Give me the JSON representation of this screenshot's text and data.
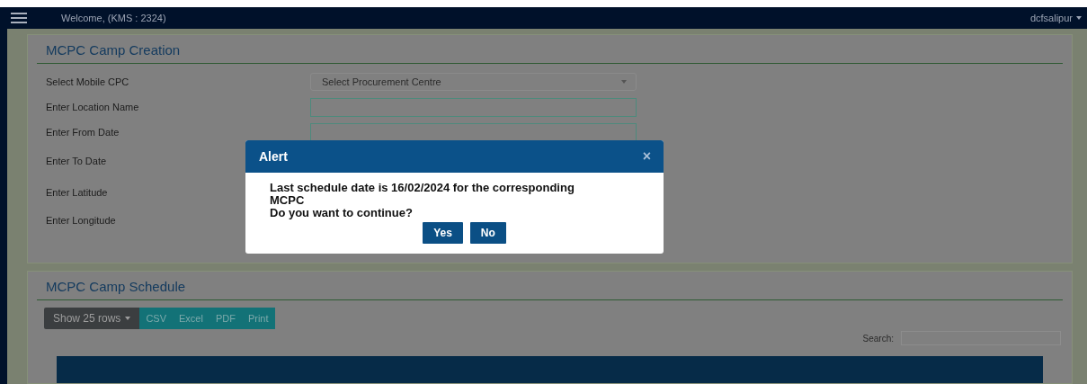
{
  "topbar": {
    "welcome": "Welcome, (KMS : 2324)",
    "user": "dcfsalipur"
  },
  "creation": {
    "title": "MCPC Camp Creation",
    "fields": [
      {
        "label": "Select Mobile CPC",
        "kind": "select",
        "placeholder": "Select Procurement Centre"
      },
      {
        "label": "Enter Location Name",
        "kind": "input"
      },
      {
        "label": "Enter From Date",
        "kind": "input"
      },
      {
        "label": "Enter To Date",
        "kind": "label"
      },
      {
        "label": "Enter Latitude",
        "kind": "label"
      },
      {
        "label": "Enter Longitude",
        "kind": "label"
      }
    ]
  },
  "schedule": {
    "title": "MCPC Camp Schedule",
    "rows_button": "Show 25 rows",
    "export_buttons": [
      "CSV",
      "Excel",
      "PDF",
      "Print"
    ],
    "search_label": "Search:"
  },
  "alert": {
    "title": "Alert",
    "close": "×",
    "message": [
      "Last schedule date is 16/02/2024 for the corresponding MCPC",
      "Do you want to continue?"
    ],
    "buttons": [
      "Yes",
      "No"
    ]
  }
}
